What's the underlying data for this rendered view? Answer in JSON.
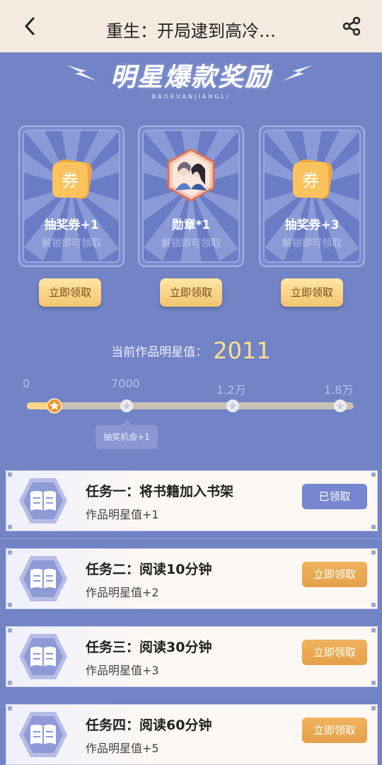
{
  "header": {
    "title": "重生：开局逮到高冷…"
  },
  "banner": {
    "title": "明星爆款奖励",
    "subtitle": "BAOKUANJIANGLI"
  },
  "rewards": [
    {
      "label": "抽奖券+1",
      "hint": "解锁即可领取",
      "coupon_text": "券",
      "button": "立即领取"
    },
    {
      "label": "勋章*1",
      "hint": "解锁即可领取",
      "button": "立即领取"
    },
    {
      "label": "抽奖券+3",
      "hint": "解锁即可领取",
      "coupon_text": "券",
      "button": "立即领取"
    }
  ],
  "star_value": {
    "label": "当前作品明星值：",
    "value": "2011"
  },
  "progress": {
    "ticks": [
      "0",
      "7000",
      "1.2万",
      "1.8万"
    ],
    "tooltip": "抽奖机会+1",
    "current_fraction": 0.08
  },
  "tasks": [
    {
      "name": "任务一：将书籍加入书架",
      "reward": "作品明星值+1",
      "button": "已领取",
      "state": "done"
    },
    {
      "name": "任务二：阅读10分钟",
      "reward": "作品明星值+2",
      "button": "立即领取",
      "state": "available"
    },
    {
      "name": "任务三：阅读30分钟",
      "reward": "作品明星值+3",
      "button": "立即领取",
      "state": "available"
    },
    {
      "name": "任务四：阅读60分钟",
      "reward": "作品明星值+5",
      "button": "立即领取",
      "state": "available"
    }
  ],
  "colors": {
    "background": "#7283c6",
    "header": "#f4eadf",
    "gold": "#ffe08a",
    "button_done": "#7686cf",
    "button_get": "#e9a84f"
  }
}
